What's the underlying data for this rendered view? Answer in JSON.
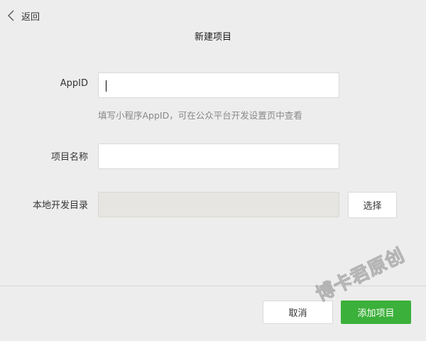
{
  "header": {
    "back_label": "返回",
    "title": "新建项目"
  },
  "form": {
    "appid": {
      "label": "AppID",
      "value": "",
      "hint": "填写小程序AppID，可在公众平台开发设置页中查看"
    },
    "project_name": {
      "label": "项目名称",
      "value": ""
    },
    "local_dir": {
      "label": "本地开发目录",
      "value": "",
      "choose_label": "选择"
    }
  },
  "footer": {
    "cancel_label": "取消",
    "add_label": "添加项目"
  },
  "watermark": "博卡君原创",
  "colors": {
    "background": "#ededed",
    "primary_green": "#3bb03a",
    "disabled_field": "#e6e5e1",
    "hint_text": "#888888"
  },
  "icons": {
    "back": "chevron-left-icon"
  }
}
